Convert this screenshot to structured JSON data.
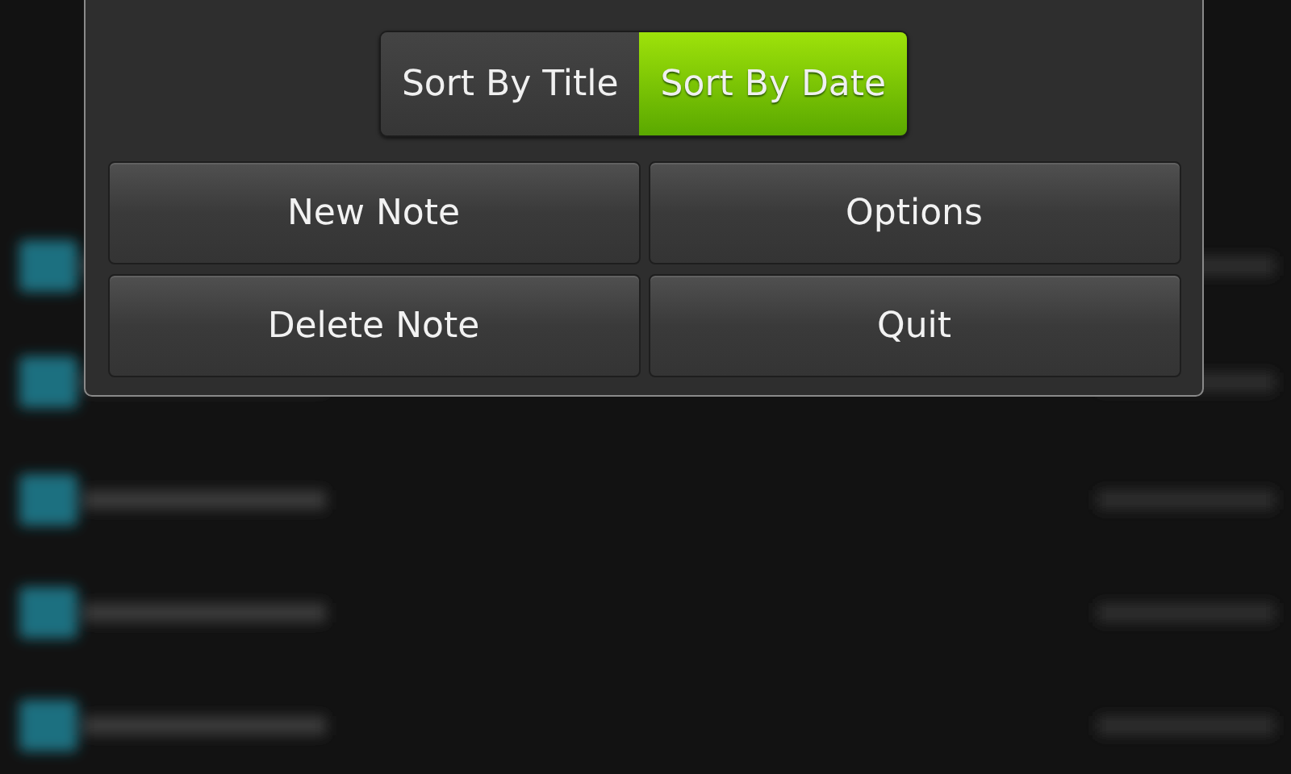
{
  "sort_toggle": [
    {
      "label": "Sort By Title",
      "selected": false
    },
    {
      "label": "Sort By Date",
      "selected": true
    }
  ],
  "menu_buttons": [
    "New Note",
    "Options",
    "Delete Note",
    "Quit"
  ]
}
